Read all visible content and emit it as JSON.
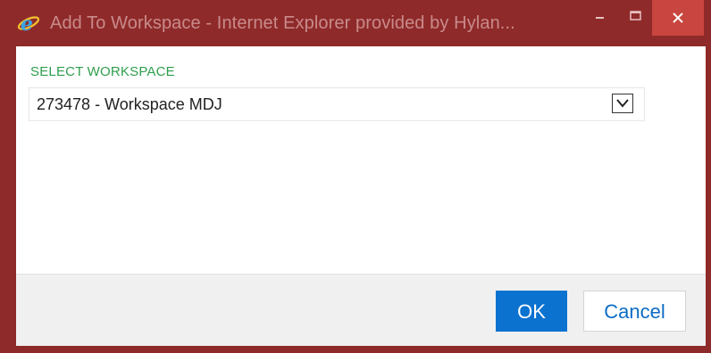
{
  "window": {
    "title": "Add To Workspace - Internet Explorer provided by Hylan...",
    "icon": "internet-explorer-icon",
    "controls": {
      "minimize_icon": "minimize-icon",
      "maximize_icon": "maximize-icon",
      "close_icon": "close-icon"
    },
    "frame_color": "#8f2a2a",
    "close_color": "#c9453f"
  },
  "form": {
    "workspace_label": "SELECT WORKSPACE",
    "workspace_selected": "273478 - Workspace MDJ",
    "dropdown_icon": "chevron-down-icon"
  },
  "footer": {
    "ok_label": "OK",
    "cancel_label": "Cancel",
    "ok_color": "#0b72d0"
  }
}
